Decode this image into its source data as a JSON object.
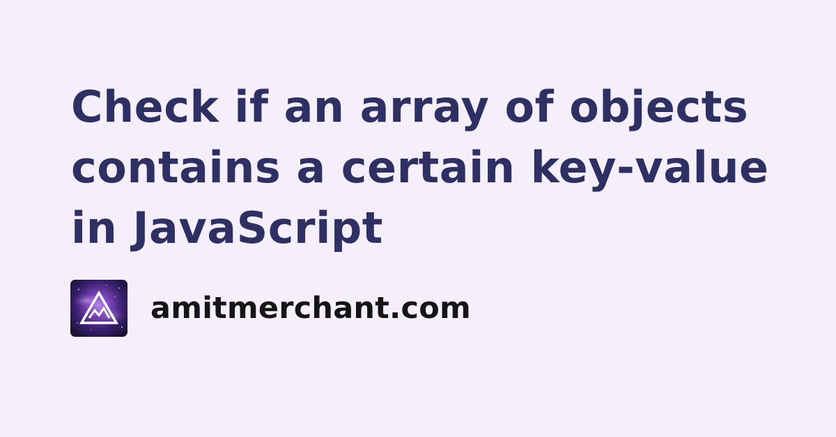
{
  "post": {
    "title": "Check if an array of objects contains a certain key-value in JavaScript"
  },
  "site": {
    "name": "amitmerchant.com",
    "logo_icon": "triangle-mountain-logo-icon"
  },
  "colors": {
    "background": "#f5effc",
    "title": "#2e2f63",
    "site_name": "#151515"
  }
}
